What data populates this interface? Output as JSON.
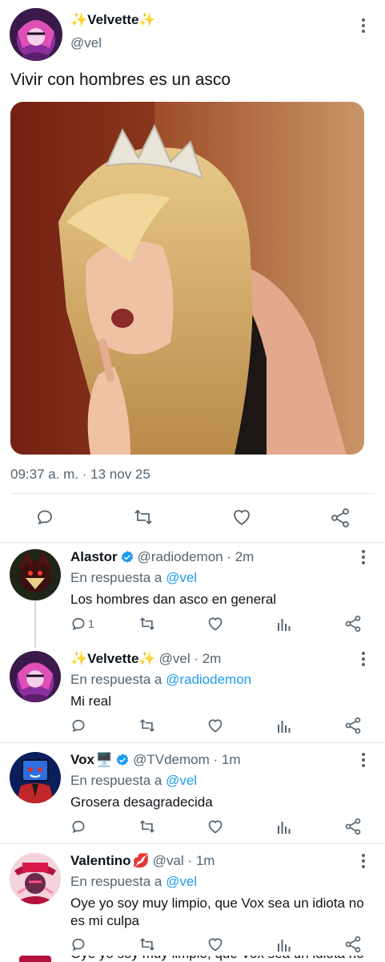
{
  "main_tweet": {
    "display_name": "✨Velvette✨",
    "handle": "@vel",
    "text": "Vivir con hombres es un asco",
    "timestamp": "09:37 a. m. · 13 nov 25"
  },
  "replies": [
    {
      "display_name": "Alastor",
      "badge": "verified",
      "handle_time": "@radiodemon · 2m",
      "replying_prefix": "En respuesta a ",
      "replying_to": "@vel",
      "text": "Los hombres dan asco en general",
      "reply_count": "1"
    },
    {
      "display_name": "✨Velvette✨",
      "handle_time": "@vel · 2m",
      "replying_prefix": "En respuesta a ",
      "replying_to": "@radiodemon",
      "text": "Mi real",
      "reply_count": ""
    },
    {
      "display_name": "Vox",
      "name_emoji": "🖥️",
      "badge": "verified",
      "handle_time": "@TVdemom · 1m",
      "replying_prefix": "En respuesta a ",
      "replying_to": "@vel",
      "text": "Grosera desagradecida",
      "reply_count": ""
    },
    {
      "display_name": "Valentino",
      "name_emoji": "💋",
      "handle_time": "@val · 1m",
      "replying_prefix": "En respuesta a ",
      "replying_to": "@vel",
      "text": "Oye yo soy muy limpio, que Vox sea un idiota no es mi culpa",
      "reply_count": ""
    }
  ],
  "cut_off_text": "Oye yo soy muy limpio, que Vox sea un idiota no",
  "colors": {
    "text": "#0f1419",
    "secondary": "#536471",
    "link": "#1d9bf0",
    "divider": "#e5e9ec"
  },
  "icons": [
    "reply-icon",
    "retweet-icon",
    "like-icon",
    "views-icon",
    "share-icon",
    "more-icon",
    "verified-icon"
  ]
}
